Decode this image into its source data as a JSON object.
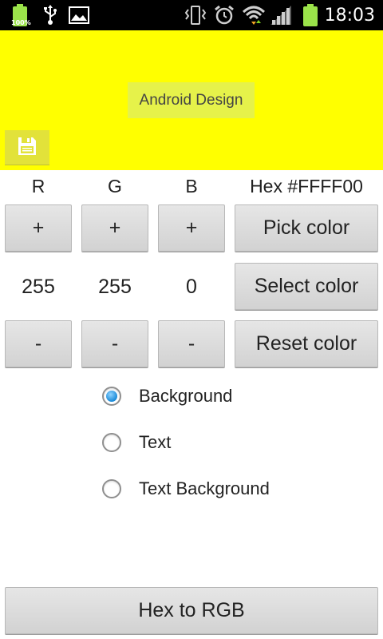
{
  "status_bar": {
    "time": "18:03",
    "battery_percent": "100%",
    "icons": [
      "battery-icon",
      "usb-icon",
      "image-icon",
      "vibrate-icon",
      "alarm-icon",
      "wifi-icon",
      "signal-icon",
      "battery-level-icon"
    ]
  },
  "preview": {
    "background_color": "#FFFF00",
    "text": "Android Design",
    "text_background_color": "#E6F24A",
    "save_button_color": "#E2E23A",
    "save_icon": "floppy-disk-icon"
  },
  "channels": {
    "r_label": "R",
    "g_label": "G",
    "b_label": "B",
    "hex_label": "Hex #FFFF00",
    "r_value": "255",
    "g_value": "255",
    "b_value": "0"
  },
  "buttons": {
    "plus": "+",
    "minus": "-",
    "pick_color": "Pick color",
    "select_color": "Select color",
    "reset_color": "Reset color",
    "hex_to_rgb": "Hex to RGB"
  },
  "target": {
    "selected": "Background",
    "options": [
      "Background",
      "Text",
      "Text Background"
    ]
  },
  "colors": {
    "status_bar": "#000000",
    "radio_selected": "#1A8AD8"
  }
}
